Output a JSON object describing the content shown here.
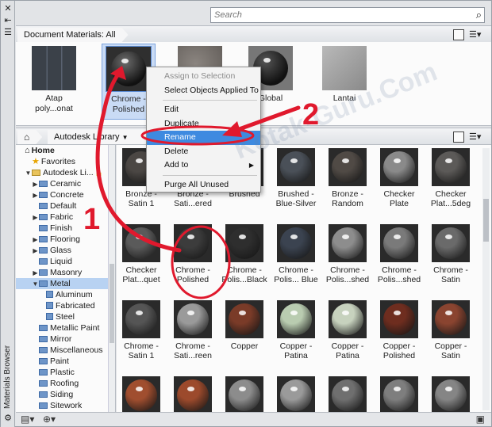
{
  "rail": {
    "title": "Materials Browser"
  },
  "search": {
    "placeholder": "Search"
  },
  "doc": {
    "breadcrumb": "Document Materials: All",
    "materials": [
      {
        "label": "Atap poly...onat",
        "look": "box-glass"
      },
      {
        "label": "Chrome - Polished",
        "look": "chrome",
        "selected": true
      },
      {
        "label": "",
        "look": "box-stone"
      },
      {
        "label": "Global",
        "look": "dark-sphere"
      },
      {
        "label": "Lantai",
        "look": "box-grey"
      }
    ]
  },
  "library": {
    "crumb_home": "⌂",
    "crumb": "Autodesk Library"
  },
  "tree": [
    {
      "label": "Home",
      "level": 0,
      "icon": "home",
      "bold": true
    },
    {
      "label": "Favorites",
      "level": 1,
      "icon": "star"
    },
    {
      "label": "Autodesk Li...",
      "level": 1,
      "icon": "folder-open",
      "arrow": "▼",
      "lock": true
    },
    {
      "label": "Ceramic",
      "level": 2,
      "icon": "folder",
      "arrow": "▶"
    },
    {
      "label": "Concrete",
      "level": 2,
      "icon": "folder",
      "arrow": "▶"
    },
    {
      "label": "Default",
      "level": 2,
      "icon": "folder"
    },
    {
      "label": "Fabric",
      "level": 2,
      "icon": "folder",
      "arrow": "▶"
    },
    {
      "label": "Finish",
      "level": 2,
      "icon": "folder"
    },
    {
      "label": "Flooring",
      "level": 2,
      "icon": "folder",
      "arrow": "▶"
    },
    {
      "label": "Glass",
      "level": 2,
      "icon": "folder",
      "arrow": "▶"
    },
    {
      "label": "Liquid",
      "level": 2,
      "icon": "folder"
    },
    {
      "label": "Masonry",
      "level": 2,
      "icon": "folder",
      "arrow": "▶"
    },
    {
      "label": "Metal",
      "level": 2,
      "icon": "folder",
      "arrow": "▼",
      "highlight": true
    },
    {
      "label": "Aluminum",
      "level": 3,
      "icon": "square"
    },
    {
      "label": "Fabricated",
      "level": 3,
      "icon": "square"
    },
    {
      "label": "Steel",
      "level": 3,
      "icon": "square"
    },
    {
      "label": "Metallic Paint",
      "level": 2,
      "icon": "folder"
    },
    {
      "label": "Mirror",
      "level": 2,
      "icon": "folder"
    },
    {
      "label": "Miscellaneous",
      "level": 2,
      "icon": "folder"
    },
    {
      "label": "Paint",
      "level": 2,
      "icon": "folder"
    },
    {
      "label": "Plastic",
      "level": 2,
      "icon": "folder"
    },
    {
      "label": "Roofing",
      "level": 2,
      "icon": "folder"
    },
    {
      "label": "Siding",
      "level": 2,
      "icon": "folder"
    },
    {
      "label": "Sitework",
      "level": 2,
      "icon": "folder"
    }
  ],
  "grid": [
    {
      "label": "Bronze -\nSatin 1",
      "color": "#4b4744"
    },
    {
      "label": "Bronze -\nSati...ered",
      "color": "#3f3c3a"
    },
    {
      "label": "Brushed",
      "color": "#666a6e"
    },
    {
      "label": "Brushed -\nBlue-Silver",
      "color": "#4a5058"
    },
    {
      "label": "Bronze -\nRandom",
      "color": "#504a45"
    },
    {
      "label": "Checker\nPlate",
      "color": "#8a8a8a"
    },
    {
      "label": "Checker\nPlat...5deg",
      "color": "#5c5a58"
    },
    {
      "label": "Checker\nPlat...quet",
      "color": "#5a5a5a"
    },
    {
      "label": "Chrome -\nPolished",
      "color": "#3c3c3c"
    },
    {
      "label": "Chrome -\nPolis...Black",
      "color": "#2e2e2e"
    },
    {
      "label": "Chrome -\nPolis... Blue",
      "color": "#3b4350"
    },
    {
      "label": "Chrome -\nPolis...shed",
      "color": "#8d8d8d"
    },
    {
      "label": "Chrome -\nPolis...shed",
      "color": "#7a7a7a"
    },
    {
      "label": "Chrome -\nSatin",
      "color": "#6a6a6a"
    },
    {
      "label": "Chrome -\nSatin 1",
      "color": "#555555"
    },
    {
      "label": "Chrome -\nSati...reen",
      "color": "#9a9a9a"
    },
    {
      "label": "Copper",
      "color": "#7a3b28"
    },
    {
      "label": "Copper -\nPatina",
      "color": "#b9ccb0"
    },
    {
      "label": "Copper -\nPatina",
      "color": "#c7d2be"
    },
    {
      "label": "Copper -\nPolished",
      "color": "#6e2d1f"
    },
    {
      "label": "Copper -\nSatin",
      "color": "#8a4430"
    },
    {
      "label": "",
      "color": "#a04e2f"
    },
    {
      "label": "",
      "color": "#9c4a2c"
    },
    {
      "label": "",
      "color": "#8c8c8c"
    },
    {
      "label": "",
      "color": "#9a9a9a"
    },
    {
      "label": "",
      "color": "#6f6f6f"
    },
    {
      "label": "",
      "color": "#7e7e7e"
    },
    {
      "label": "",
      "color": "#858585"
    }
  ],
  "context_menu": [
    {
      "label": "Assign to Selection",
      "disabled": true
    },
    {
      "label": "Select Objects Applied To"
    },
    {
      "sep": true
    },
    {
      "label": "Edit"
    },
    {
      "label": "Duplicate"
    },
    {
      "label": "Rename",
      "active": true
    },
    {
      "label": "Delete"
    },
    {
      "label": "Add to",
      "submenu": true
    },
    {
      "sep": true
    },
    {
      "label": "Purge All Unused"
    }
  ],
  "annotations": {
    "step1": "1",
    "step2": "2",
    "watermark": "Kotak-Guru.Com",
    "accent": "#e0192d"
  }
}
